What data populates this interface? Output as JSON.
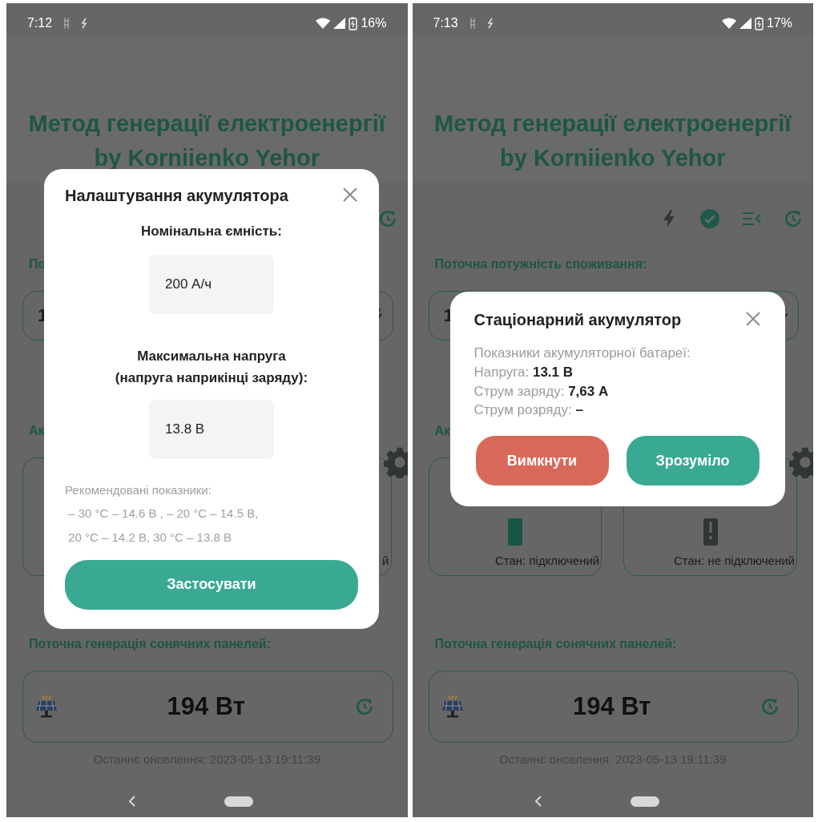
{
  "screens": [
    {
      "status_bar": {
        "time": "7:12",
        "battery": "16%"
      },
      "title_lines": [
        "Метод генерації електроенергії",
        "by Korniienko Yehor"
      ],
      "toolbar": [
        {
          "kind": "refresh"
        }
      ],
      "consumption": {
        "heading": "По",
        "value": "1"
      },
      "battery_section": {
        "heading": "Ак",
        "cards": [
          {
            "kind": "covered"
          },
          {
            "kind": "device",
            "status": "й"
          }
        ]
      },
      "solar": {
        "heading": "Поточна генерація сонячних панелей:",
        "value": "194 Вт",
        "updated": "Останнє оновлення: 2023-05-13 19:11:39"
      },
      "modal": {
        "kind": "settings",
        "title": "Налаштування акумулятора",
        "fields": [
          {
            "label_lines": [
              "Номінальна ємність:"
            ],
            "value": "200 А/ч"
          },
          {
            "label_lines": [
              "Максимальна напруга",
              "(напруга наприкінці заряду):"
            ],
            "value": "13.8 В"
          }
        ],
        "note_lines": [
          "Рекомендовані показники:",
          " – 30 °C – 14.6 В , – 20 °C – 14.5 В,",
          " 20 °C – 14.2 В, 30 °C – 13.8 В"
        ],
        "buttons": [
          {
            "label": "Застосувати",
            "kind": "primary"
          }
        ]
      }
    },
    {
      "status_bar": {
        "time": "7:13",
        "battery": "17%"
      },
      "title_lines": [
        "Метод генерації електроенергії",
        "by Korniienko Yehor"
      ],
      "toolbar": [
        {
          "kind": "bolt"
        },
        {
          "kind": "check"
        },
        {
          "kind": "list"
        },
        {
          "kind": "refresh"
        }
      ],
      "consumption": {
        "heading": "Поточна потужність споживання:",
        "value": "1"
      },
      "battery_section": {
        "heading": "Ак",
        "cards": [
          {
            "kind": "device",
            "connected": true,
            "status": "Стан: підключений"
          },
          {
            "kind": "device",
            "connected": false,
            "status": "Стан: не підключений"
          }
        ]
      },
      "solar": {
        "heading": "Поточна генерація сонячних панелей:",
        "value": "194 Вт",
        "updated": "Останнє оновлення: 2023-05-13 19:11:39"
      },
      "modal": {
        "kind": "info",
        "title": "Стаціонарний акумулятор",
        "lines": [
          "Показники акумуляторної батареї:",
          "Напруга: **13.1 В**",
          "Струм заряду: **7,63 А**",
          "Струм розряду: **–**"
        ],
        "buttons": [
          {
            "label": "Вимкнути",
            "kind": "danger"
          },
          {
            "label": "Зрозуміло",
            "kind": "primary"
          }
        ]
      }
    }
  ]
}
